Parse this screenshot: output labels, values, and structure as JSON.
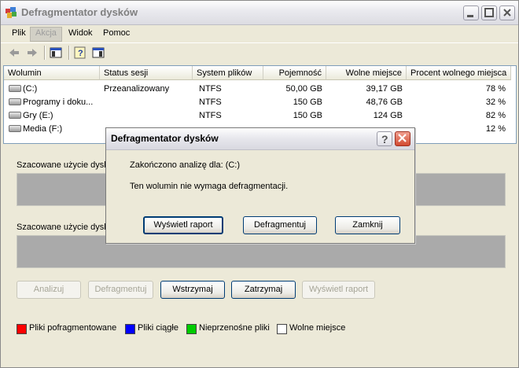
{
  "window": {
    "title": "Defragmentator dysków"
  },
  "menu": [
    "Plik",
    "Akcja",
    "Widok",
    "Pomoc"
  ],
  "table": {
    "columns": [
      "Wolumin",
      "Status sesji",
      "System plików",
      "Pojemność",
      "Wolne miejsce",
      "Procent wolnego miejsca"
    ],
    "rows": [
      {
        "volume": "(C:)",
        "status": "Przeanalizowany",
        "fs": "NTFS",
        "capacity": "50,00 GB",
        "free": "39,17 GB",
        "percent": "78 %"
      },
      {
        "volume": "Programy i doku...",
        "status": "",
        "fs": "NTFS",
        "capacity": "150 GB",
        "free": "48,76 GB",
        "percent": "32 %"
      },
      {
        "volume": "Gry (E:)",
        "status": "",
        "fs": "NTFS",
        "capacity": "150 GB",
        "free": "124 GB",
        "percent": "82 %"
      },
      {
        "volume": "Media (F:)",
        "status": "",
        "fs": "",
        "capacity": "",
        "free": "",
        "percent": "12 %"
      }
    ]
  },
  "sections": {
    "before_label": "Szacowane użycie dysk",
    "after_label": "Szacowane użycie dysk"
  },
  "buttons": {
    "analyze": "Analizuj",
    "defrag": "Defragmentuj",
    "pause": "Wstrzymaj",
    "stop": "Zatrzymaj",
    "report": "Wyświetl raport"
  },
  "legend": [
    {
      "label": "Pliki pofragmentowane",
      "color": "#ff0000"
    },
    {
      "label": "Pliki ciągłe",
      "color": "#0000ff"
    },
    {
      "label": "Nieprzenośne pliki",
      "color": "#00cc00"
    },
    {
      "label": "Wolne miejsce",
      "color": "#ffffff"
    }
  ],
  "dialog": {
    "title": "Defragmentator dysków",
    "line1": "Zakończono analizę dla: (C:)",
    "line2": "Ten wolumin nie wymaga defragmentacji.",
    "report_button": "Wyświetl raport",
    "defrag_button": "Defragmentuj",
    "close_button": "Zamknij"
  }
}
